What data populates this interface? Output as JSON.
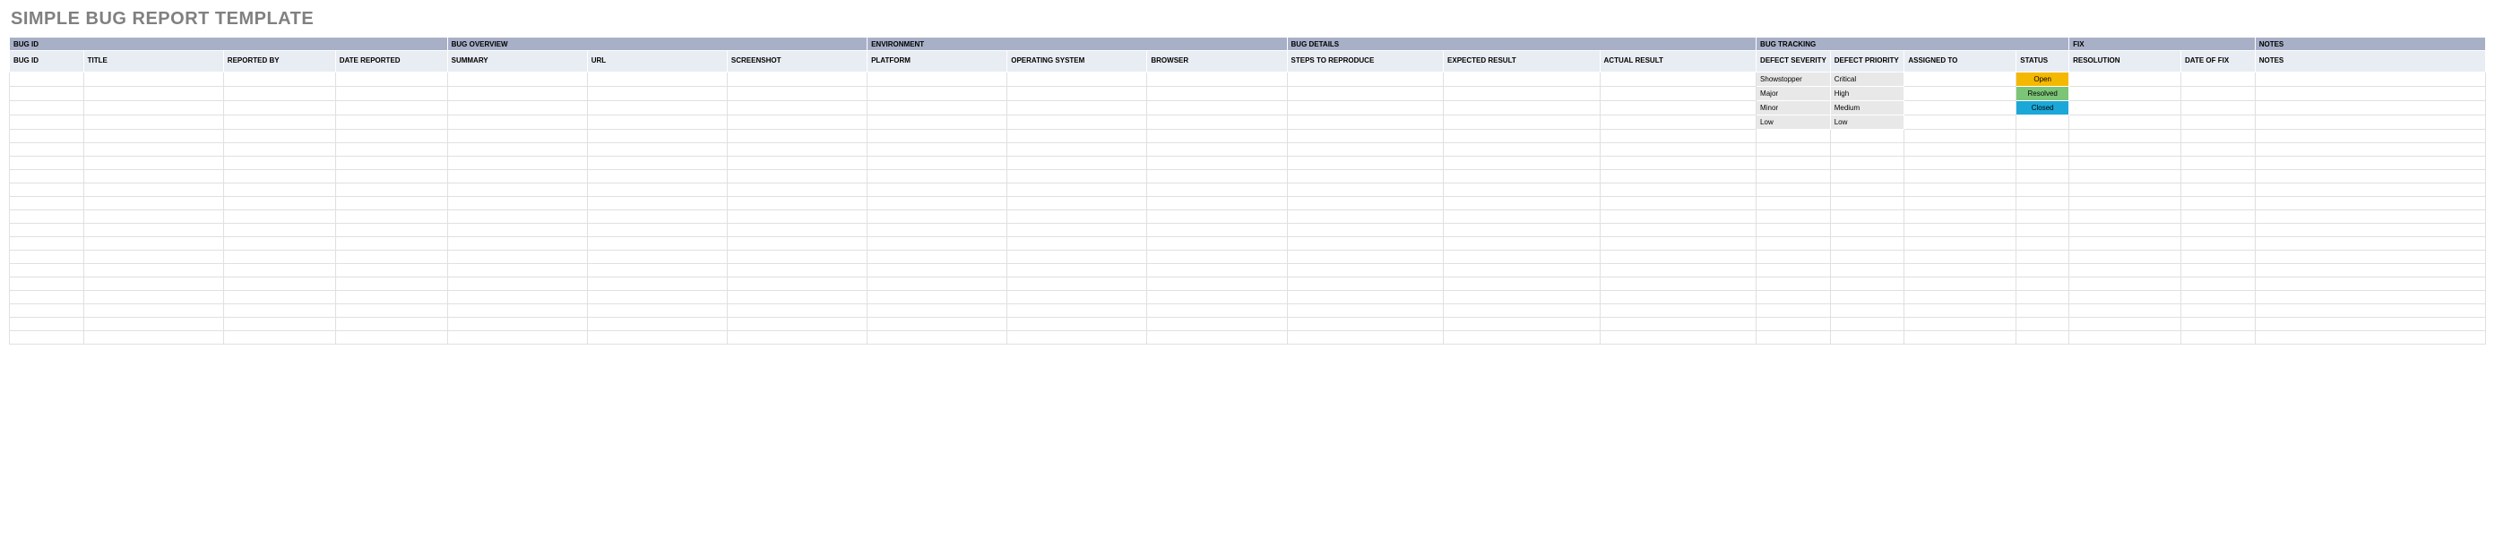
{
  "title": "SIMPLE BUG REPORT TEMPLATE",
  "groups": {
    "bug_id": "BUG ID",
    "bug_overview": "BUG OVERVIEW",
    "environment": "ENVIRONMENT",
    "bug_details": "BUG DETAILS",
    "bug_tracking": "BUG TRACKING",
    "fix": "FIX",
    "notes": "NOTES"
  },
  "columns": {
    "bug_id": "BUG ID",
    "title": "TITLE",
    "reported_by": "REPORTED BY",
    "date_reported": "DATE REPORTED",
    "summary": "SUMMARY",
    "url": "URL",
    "screenshot": "SCREENSHOT",
    "platform": "PLATFORM",
    "operating_system": "OPERATING SYSTEM",
    "browser": "BROWSER",
    "steps_to_reproduce": "STEPS TO REPRODUCE",
    "expected_result": "EXPECTED RESULT",
    "actual_result": "ACTUAL RESULT",
    "defect_severity": "DEFECT SEVERITY",
    "defect_priority": "DEFECT PRIORITY",
    "assigned_to": "ASSIGNED TO",
    "status": "STATUS",
    "resolution": "RESOLUTION",
    "date_of_fix": "DATE OF FIX",
    "notes": "NOTES"
  },
  "rows": [
    {
      "severity": "Showstopper",
      "priority": "Critical",
      "status": "Open",
      "status_class": "status-open"
    },
    {
      "severity": "Major",
      "priority": "High",
      "status": "Resolved",
      "status_class": "status-resolved"
    },
    {
      "severity": "Minor",
      "priority": "Medium",
      "status": "Closed",
      "status_class": "status-closed"
    },
    {
      "severity": "Low",
      "priority": "Low",
      "status": "",
      "status_class": ""
    },
    {
      "severity": "",
      "priority": "",
      "status": "",
      "status_class": ""
    },
    {
      "severity": "",
      "priority": "",
      "status": "",
      "status_class": ""
    },
    {
      "severity": "",
      "priority": "",
      "status": "",
      "status_class": ""
    },
    {
      "severity": "",
      "priority": "",
      "status": "",
      "status_class": ""
    },
    {
      "severity": "",
      "priority": "",
      "status": "",
      "status_class": ""
    },
    {
      "severity": "",
      "priority": "",
      "status": "",
      "status_class": ""
    },
    {
      "severity": "",
      "priority": "",
      "status": "",
      "status_class": ""
    },
    {
      "severity": "",
      "priority": "",
      "status": "",
      "status_class": ""
    },
    {
      "severity": "",
      "priority": "",
      "status": "",
      "status_class": ""
    },
    {
      "severity": "",
      "priority": "",
      "status": "",
      "status_class": ""
    },
    {
      "severity": "",
      "priority": "",
      "status": "",
      "status_class": ""
    },
    {
      "severity": "",
      "priority": "",
      "status": "",
      "status_class": ""
    },
    {
      "severity": "",
      "priority": "",
      "status": "",
      "status_class": ""
    },
    {
      "severity": "",
      "priority": "",
      "status": "",
      "status_class": ""
    },
    {
      "severity": "",
      "priority": "",
      "status": "",
      "status_class": ""
    },
    {
      "severity": "",
      "priority": "",
      "status": "",
      "status_class": ""
    }
  ]
}
